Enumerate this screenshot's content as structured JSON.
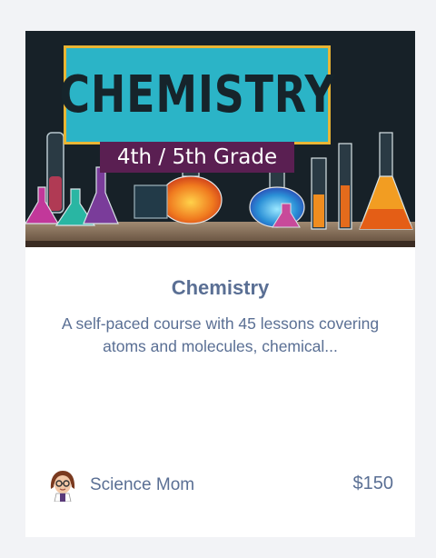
{
  "card": {
    "banner": {
      "title": "CHEMISTRY",
      "subtitle": "4th / 5th Grade"
    },
    "title": "Chemistry",
    "description": "A self-paced course with 45 lessons covering atoms and molecules, chemical...",
    "author": "Science Mom",
    "price": "$150",
    "avatar_icon": "science-mom-avatar-icon"
  },
  "colors": {
    "text": "#5a6f94",
    "banner_bg": "#121a1f",
    "title_box": "#2bb4c7",
    "title_border": "#e9b534",
    "subtitle_bg": "#5a1f52"
  }
}
